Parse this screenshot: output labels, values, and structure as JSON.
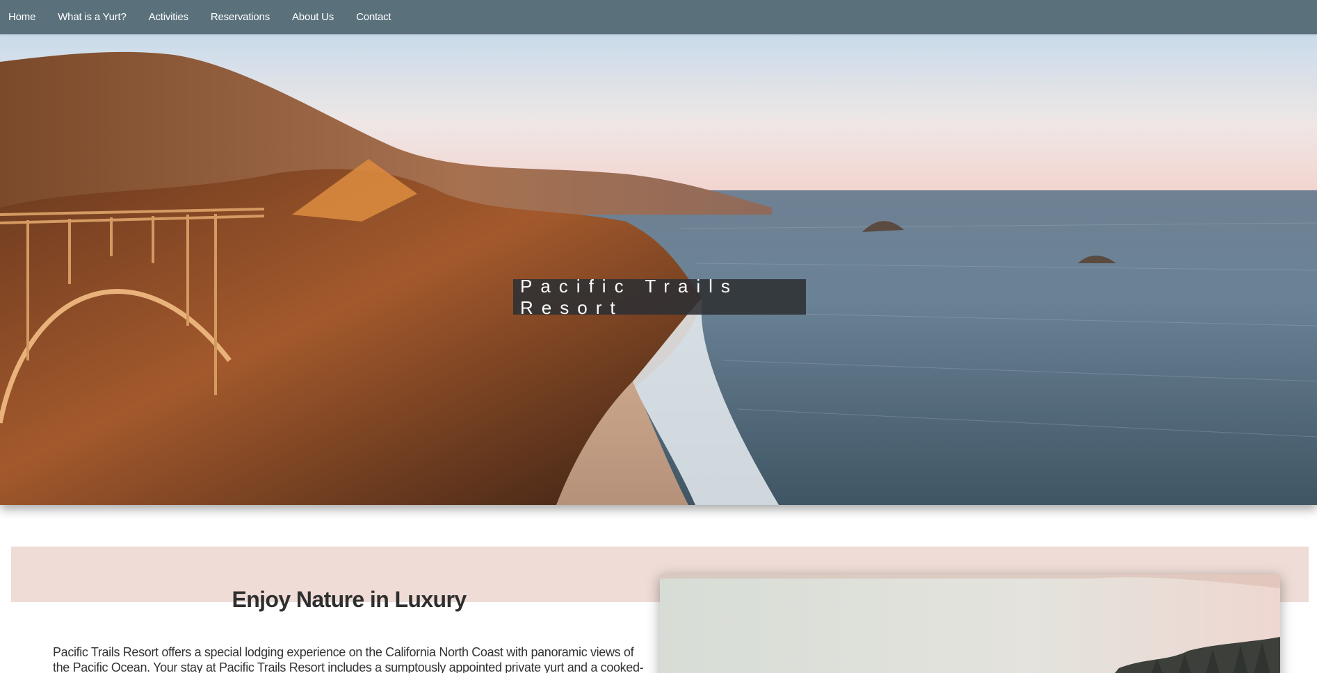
{
  "nav": {
    "items": [
      {
        "label": "Home"
      },
      {
        "label": "What is a Yurt?"
      },
      {
        "label": "Activities"
      },
      {
        "label": "Reservations"
      },
      {
        "label": "About Us"
      },
      {
        "label": "Contact"
      }
    ]
  },
  "hero": {
    "title": "Pacific Trails Resort",
    "image": "coastal-cliffs-bridge-ocean"
  },
  "main": {
    "heading": "Enjoy Nature in Luxury",
    "intro": "Pacific Trails Resort offers a special lodging experience on the California North Coast with panoramic views of the Pacific Ocean. Your stay at Pacific Trails Resort includes a sumptously appointed private yurt and a cooked-to-order breakfast each",
    "side_image": "coastline-sunset-trees"
  },
  "colors": {
    "nav_bg": "#5a717c",
    "band": "#efdcd7",
    "title_box": "#2d3033"
  }
}
